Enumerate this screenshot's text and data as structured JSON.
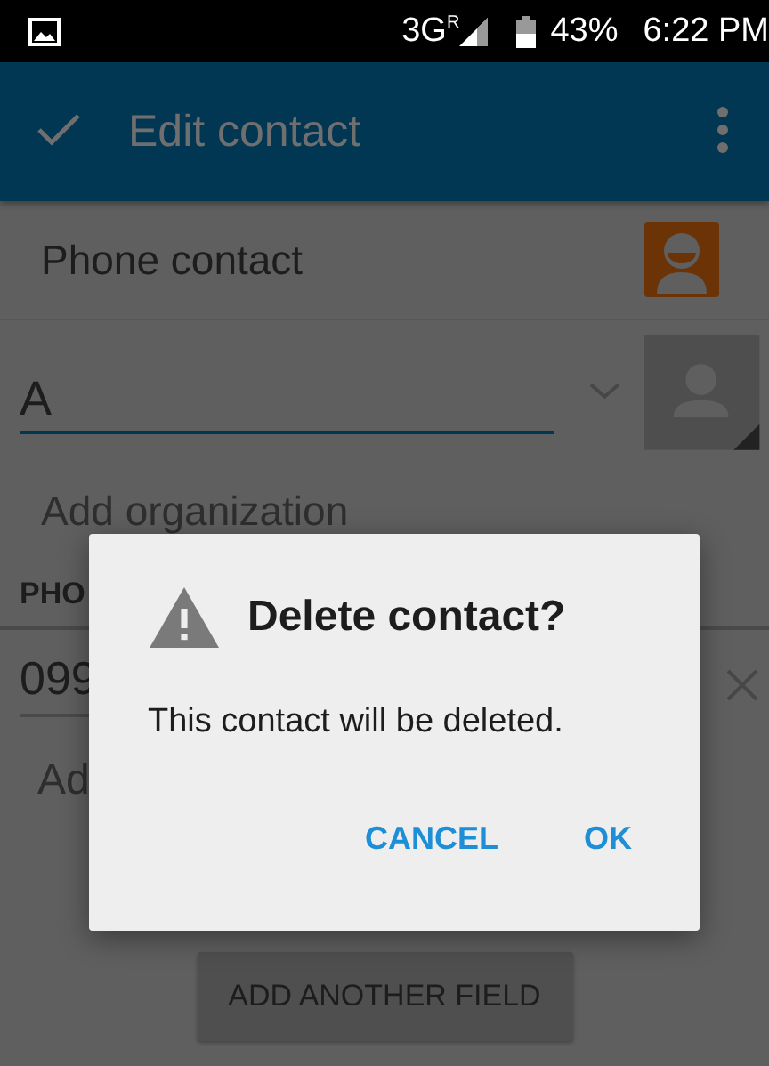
{
  "status_bar": {
    "network": "3G$^{R}$",
    "battery": "43%",
    "time": "6:22 PM"
  },
  "app_bar": {
    "title": "Edit contact"
  },
  "account": {
    "label": "Phone contact"
  },
  "name_field": {
    "value": "A"
  },
  "organization": {
    "label": "Add organization"
  },
  "phone_section": {
    "heading": "PHO",
    "value": "099"
  },
  "add_row": {
    "label": "Ad"
  },
  "add_field_button": {
    "label": "ADD ANOTHER FIELD"
  },
  "dialog": {
    "title": "Delete contact?",
    "message": "This contact will be deleted.",
    "buttons": [
      {
        "label": "CANCEL"
      },
      {
        "label": "OK"
      }
    ]
  }
}
